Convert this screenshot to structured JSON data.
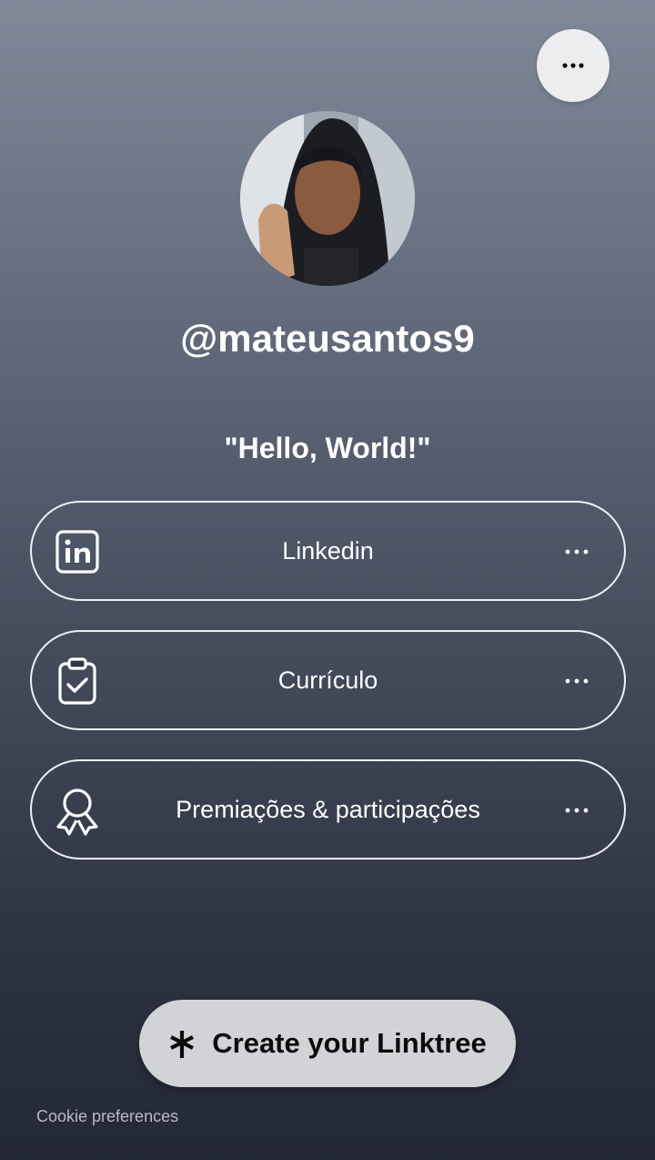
{
  "header": {
    "menu_icon": "more-horizontal-icon"
  },
  "profile": {
    "avatar_icon": "profile-photo",
    "username": "@mateusantos9",
    "bio": "\"Hello, World!\""
  },
  "links": [
    {
      "label": "Linkedin",
      "icon": "linkedin-icon",
      "more_icon": "more-horizontal-icon"
    },
    {
      "label": "Currículo",
      "icon": "clipboard-check-icon",
      "more_icon": "more-horizontal-icon"
    },
    {
      "label": "Premiações & participações",
      "icon": "award-ribbon-icon",
      "more_icon": "more-horizontal-icon"
    }
  ],
  "footer": {
    "cta_label": "Create your Linktree",
    "cta_icon": "linktree-asterisk-icon",
    "cookie_label": "Cookie preferences"
  },
  "colors": {
    "background_top": "#7f8998",
    "background_bottom": "#232836",
    "text": "#ffffff",
    "button_border": "#eef0f3",
    "cta_background": "#d2d3d7"
  }
}
